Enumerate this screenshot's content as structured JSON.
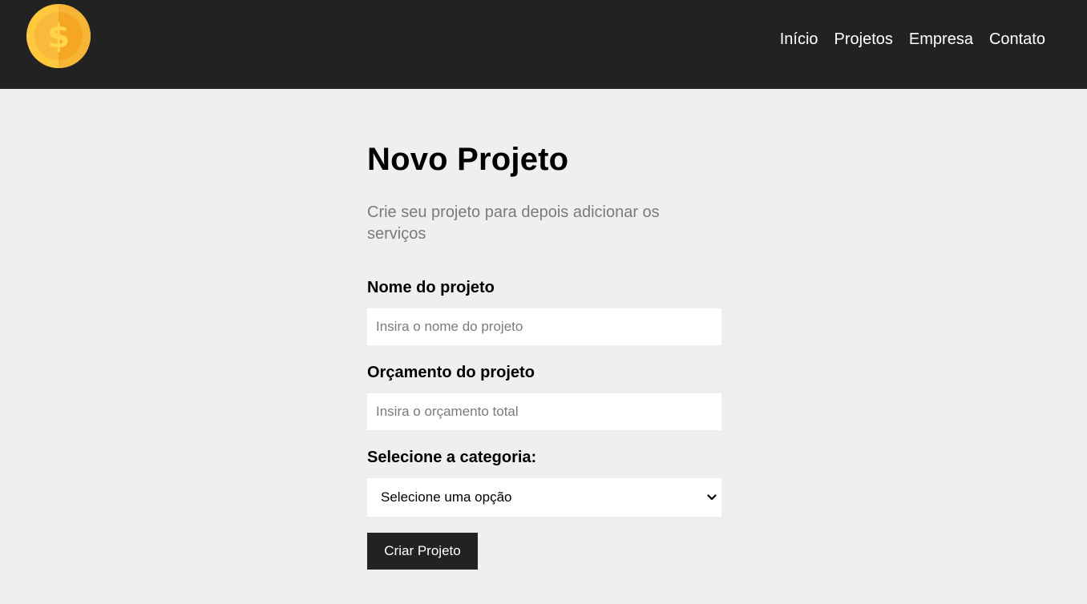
{
  "navbar": {
    "logo_icon": "dollar-coin-icon",
    "links": [
      {
        "label": "Início"
      },
      {
        "label": "Projetos"
      },
      {
        "label": "Empresa"
      },
      {
        "label": "Contato"
      }
    ]
  },
  "main": {
    "title": "Novo Projeto",
    "subtitle": "Crie seu projeto para depois adicionar os serviços",
    "form": {
      "name_label": "Nome do projeto",
      "name_placeholder": "Insira o nome do projeto",
      "budget_label": "Orçamento do projeto",
      "budget_placeholder": "Insira o orçamento total",
      "category_label": "Selecione a categoria:",
      "category_selected": "Selecione uma opção",
      "submit_label": "Criar Projeto"
    }
  },
  "colors": {
    "navbar_bg": "#222222",
    "page_bg": "#efefef",
    "coin_outer": "#ffc83d",
    "coin_inner": "#f5a623",
    "button_bg": "#222222"
  }
}
